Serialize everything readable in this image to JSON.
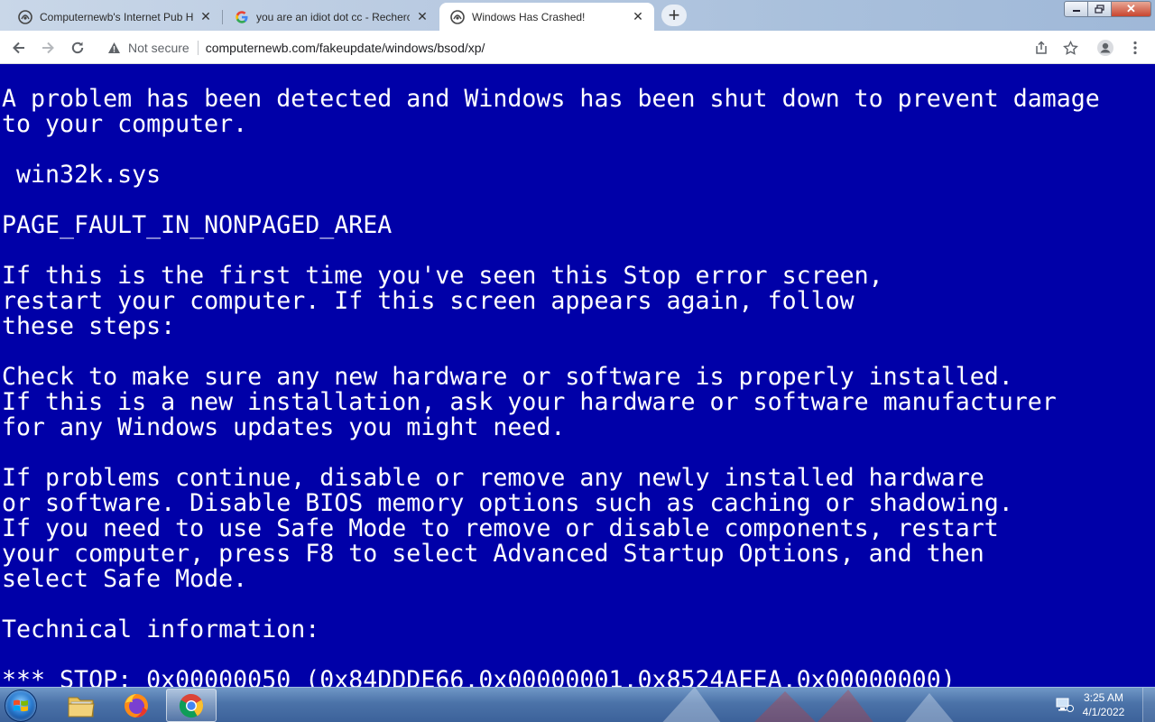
{
  "browser": {
    "tabs": [
      {
        "title": "Computernewb's Internet Pub Hub",
        "icon": "computernewb-favicon-icon",
        "active": false
      },
      {
        "title": "you are an idiot dot cc - Recherche Google",
        "icon": "google-g-icon",
        "active": false
      },
      {
        "title": "Windows Has Crashed!",
        "icon": "computernewb-favicon-icon",
        "active": true
      }
    ],
    "new_tab_label": "+",
    "security_label": "Not secure",
    "url": "computernewb.com/fakeupdate/windows/bsod/xp/"
  },
  "bsod": {
    "background_color": "#0000a8",
    "text_color": "#ffffff",
    "lines": [
      "A problem has been detected and Windows has been shut down to prevent damage",
      "to your computer.",
      "",
      " win32k.sys",
      "",
      "PAGE_FAULT_IN_NONPAGED_AREA",
      "",
      "If this is the first time you've seen this Stop error screen,",
      "restart your computer. If this screen appears again, follow",
      "these steps:",
      "",
      "Check to make sure any new hardware or software is properly installed.",
      "If this is a new installation, ask your hardware or software manufacturer",
      "for any Windows updates you might need.",
      "",
      "If problems continue, disable or remove any newly installed hardware",
      "or software. Disable BIOS memory options such as caching or shadowing.",
      "If you need to use Safe Mode to remove or disable components, restart",
      "your computer, press F8 to select Advanced Startup Options, and then",
      "select Safe Mode.",
      "",
      "Technical information:",
      "",
      "*** STOP: 0x00000050 (0x84DDDE66,0x00000001,0x8524AEEA,0x00000000)"
    ]
  },
  "taskbar": {
    "pinned": [
      {
        "name": "file-explorer",
        "icon": "folder-icon",
        "active": false
      },
      {
        "name": "firefox",
        "icon": "firefox-icon",
        "active": false
      },
      {
        "name": "chrome",
        "icon": "chrome-icon",
        "active": true
      }
    ],
    "clock_time": "3:25 AM",
    "clock_date": "4/1/2022"
  }
}
